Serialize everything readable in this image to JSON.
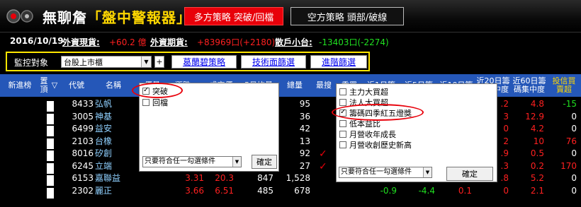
{
  "header": {
    "title_prefix": "無聊詹",
    "title_highlight": "「盤中警報器」",
    "multi_strategy_button": "多方策略 突破/回檔",
    "short_strategy_button": "空方策略 頭部/破線"
  },
  "info": {
    "date": "2016/10/19",
    "foreign_spot_label": "外資現貨:",
    "foreign_spot_value": "+60.2 億",
    "foreign_futures_label": "外資期貨:",
    "foreign_futures_value": "+83969口(+2180)",
    "retail_label": "散戶小台:",
    "retail_value": "-13403口(-2274)"
  },
  "controls": {
    "label": "監控對象",
    "market_select": "台股上市櫃",
    "plus": "+",
    "btn_gaolan": "葛蘭碧策略",
    "btn_tech": "技術面篩選",
    "btn_advanced": "進階篩選"
  },
  "table": {
    "headers": {
      "new_tracking": "新進榜",
      "pin": "置頂",
      "sort_arrow": "▽",
      "code": "代號",
      "name": "名稱",
      "price": "價量",
      "change": "漲跌",
      "turnover": "成交價",
      "avg5": "5日均量",
      "volume": "總量",
      "highest": "最搜",
      "tier": "委買",
      "chip1": "近1日籌",
      "chip5": "近5日籌",
      "chip10": "近10日籌",
      "chip20": "近20日籌 碼集中度",
      "chip60": "近60日籌 碼集中度",
      "investment": "投信買 賣超"
    },
    "rows": [
      {
        "code": "8433",
        "name": "弘帆",
        "c1": "",
        "c2": "",
        "c3": "",
        "c4": "95",
        "v1": "",
        "v2": "",
        "v3": "",
        "v4": ".2",
        "v5": "4.8",
        "v6": "-15"
      },
      {
        "code": "3005",
        "name": "神基",
        "c1": "",
        "c2": "",
        "c3": "",
        "c4": "36",
        "v1": "",
        "v2": "",
        "v3": "",
        "v4": "3",
        "v5": "12.9",
        "v6": "0"
      },
      {
        "code": "6499",
        "name": "益安",
        "c1": "",
        "c2": "",
        "c3": "",
        "c4": "42",
        "v1": "",
        "v2": "",
        "v3": "",
        "v4": "0",
        "v5": "4.2",
        "v6": "0"
      },
      {
        "code": "2103",
        "name": "台橡",
        "c1": "",
        "c2": "",
        "c3": "",
        "c4": "13",
        "v1": "",
        "v2": "",
        "v3": "",
        "v4": "2",
        "v5": "10",
        "v6": "76"
      },
      {
        "code": "8016",
        "name": "矽創",
        "c1": "",
        "c2": "",
        "c3": "",
        "c4": "92",
        "v1": "",
        "v2": "",
        "v3": "",
        "v4": ".9",
        "v5": "0.5",
        "v6": "0"
      },
      {
        "code": "6245",
        "name": "立端",
        "c1": "",
        "c2": "",
        "c3": "",
        "c4": "27",
        "v1": "",
        "v2": "",
        "v3": "",
        "v4": ".3",
        "v5": "0.2",
        "v6": "170"
      },
      {
        "code": "6153",
        "name": "嘉聯益",
        "c1": "3.31",
        "c2": "20.3",
        "c3": "847",
        "c4": "1,528",
        "v1": "",
        "v2": "",
        "v3": "",
        "v4": ".8",
        "v5": "5.2",
        "v6": "0"
      },
      {
        "code": "2302",
        "name": "麗正",
        "c1": "3.66",
        "c2": "6.51",
        "c3": "485",
        "c4": "678",
        "v1": "-0.9",
        "v2": "-4.4",
        "v3": "0.1",
        "v4": "0",
        "v5": "2.1",
        "v6": "0"
      }
    ]
  },
  "popup_left": {
    "opt1": "突破",
    "opt2": "回檔",
    "mode_select": "只要符合任一勾選條件",
    "confirm": "確定"
  },
  "popup_right": {
    "opt1": "主力大買超",
    "opt2": "法人大買超",
    "opt3": "籌碼四季紅五燈獎",
    "opt4": "低本益比",
    "opt5": "月營收年成長",
    "opt6": "月營收創歷史新高",
    "mode_select": "只要符合任一勾選條件",
    "confirm": "確定"
  }
}
